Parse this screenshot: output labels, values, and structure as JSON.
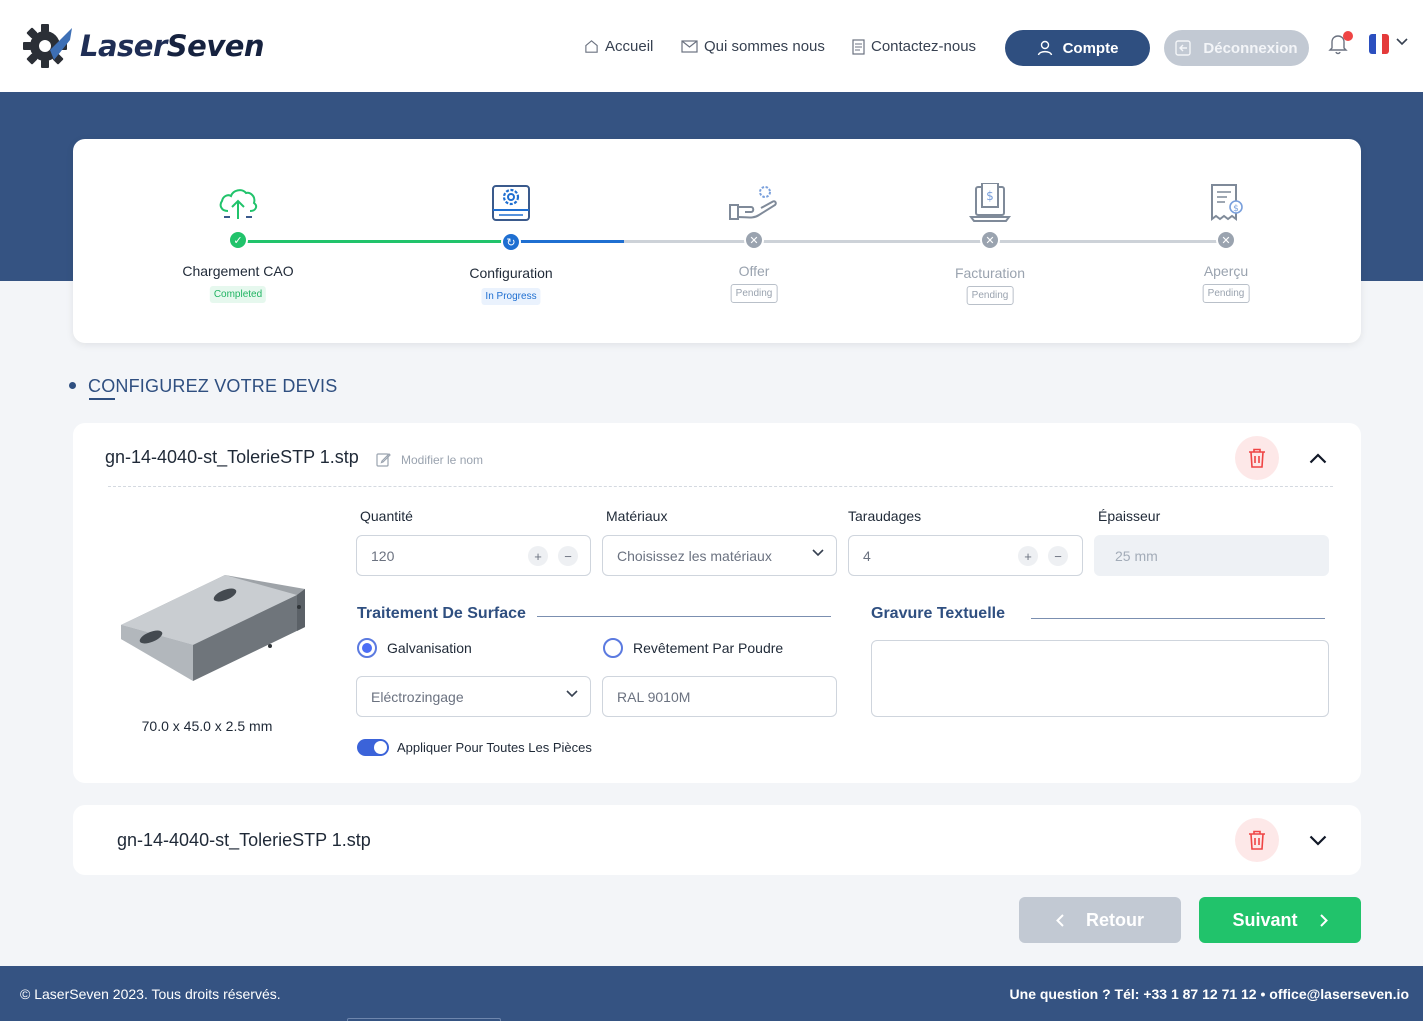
{
  "brand": {
    "name_part1": "Laser",
    "name_part2": "Seven"
  },
  "nav": {
    "home": "Accueil",
    "about": "Qui sommes nous",
    "contact": "Contactez-nous",
    "account": "Compte",
    "logout": "Déconnexion"
  },
  "stepper": {
    "steps": [
      {
        "label": "Chargement CAO",
        "status": "Completed"
      },
      {
        "label": "Configuration",
        "status": "In Progress"
      },
      {
        "label": "Offer",
        "status": "Pending"
      },
      {
        "label": "Facturation",
        "status": "Pending"
      },
      {
        "label": "Aperçu",
        "status": "Pending"
      }
    ]
  },
  "section": {
    "title": "CONFIGUREZ VOTRE DEVIS"
  },
  "part1": {
    "file_name": "gn-14-4040-st_TolerieSTP 1.stp",
    "edit_label": "Modifier le nom",
    "dimensions": "70.0 x 45.0 x 2.5 mm",
    "quantity": {
      "label": "Quantité",
      "value": "120"
    },
    "materials": {
      "label": "Matériaux",
      "placeholder": "Choisissez les matériaux"
    },
    "tapping": {
      "label": "Taraudages",
      "value": "4"
    },
    "thickness": {
      "label": "Épaisseur",
      "value": "25 mm"
    },
    "surface_treatment": {
      "title": "Traitement De Surface",
      "option1": "Galvanisation",
      "option2": "Revêtement Par Poudre",
      "selected": "Galvanisation",
      "galv_type": "Eléctrozingage",
      "ral_color": "RAL 9010M"
    },
    "engraving": {
      "title": "Gravure Textuelle",
      "value": ""
    },
    "apply_all": {
      "label": "Appliquer Pour Toutes Les Pièces",
      "enabled": true
    }
  },
  "part2": {
    "file_name": "gn-14-4040-st_TolerieSTP 1.stp"
  },
  "actions": {
    "back": "Retour",
    "next": "Suivant"
  },
  "footer": {
    "copyright": "© LaserSeven 2023. Tous droits réservés.",
    "contact": "Une question ? Tél: +33 1 87 12 71 12 • office@laserseven.io"
  },
  "colors": {
    "primary": "#2f4f80",
    "band": "#355382",
    "success": "#21c36b",
    "progress": "#1f6fd1",
    "danger": "#ef4444"
  }
}
